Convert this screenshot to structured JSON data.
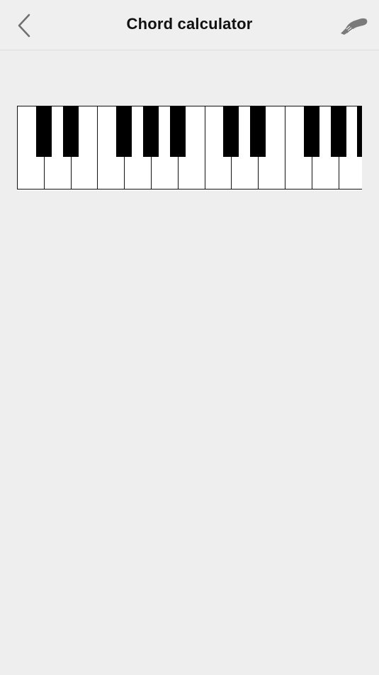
{
  "header": {
    "title": "Chord calculator",
    "back_icon": "chevron-left-icon",
    "right_icon": "guitar-headstock-icon"
  },
  "keyboard": {
    "white_keys": [
      "C",
      "D",
      "E",
      "F",
      "G",
      "A",
      "B",
      "C",
      "D",
      "E",
      "F",
      "G",
      "A"
    ],
    "black_keys": [
      "C#",
      "D#",
      "F#",
      "G#",
      "A#",
      "C#",
      "D#",
      "F#",
      "G#",
      "A#"
    ],
    "colors": {
      "white": "#ffffff",
      "black": "#000000",
      "outline": "#111111"
    }
  },
  "colors": {
    "background": "#eeeeee",
    "header_divider": "#dcdcdc",
    "icon_gray": "#7a7a7a",
    "title_text": "#111111"
  }
}
